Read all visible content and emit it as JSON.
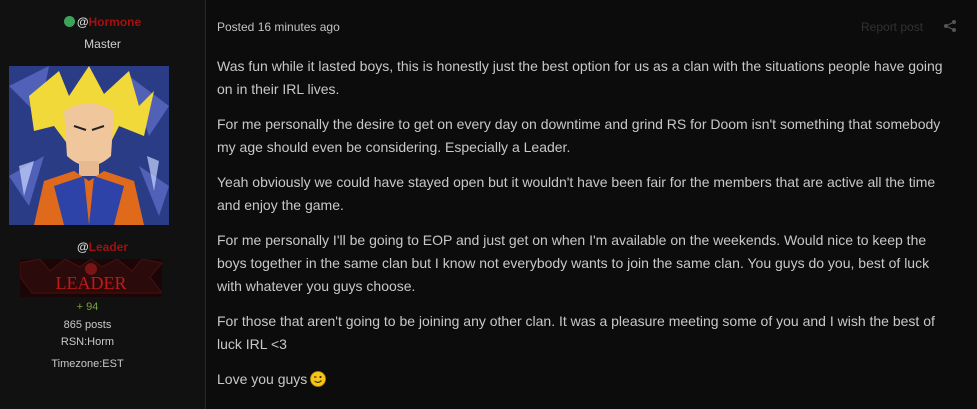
{
  "author": {
    "at": "@",
    "name": "Hormone",
    "rank": "Master",
    "online_color": "#3aa55a",
    "name_color": "#a31010"
  },
  "group": {
    "at": "@",
    "name": "Leader",
    "badge_text": "LEADER"
  },
  "stats": {
    "reputation": "94",
    "posts": "865 posts",
    "rsn": "RSN:Horm",
    "timezone": "Timezone:EST"
  },
  "post": {
    "meta": "Posted 16 minutes ago",
    "report_label": "Report post",
    "share_icon": "share-icon",
    "paragraphs": [
      "Was fun while it lasted boys, this is honestly just the best option for us as a clan with the situations people have going on in their IRL lives.",
      "For me personally the desire to get on every day on downtime and grind RS for Doom isn't something that somebody my age should even be considering.  Especially a Leader.",
      "Yeah obviously we could have stayed open but it wouldn't have been fair for the members that are active all the time and enjoy the game.",
      "For me personally I'll be going to EOP and just get on when I'm available on the weekends.  Would nice to keep the boys together in the same clan but I know not everybody wants to join the same clan.  You guys do you, best of luck with whatever you guys choose.",
      "For those that aren't going to be joining any other clan.  It was a pleasure meeting some of you and I wish the best of luck IRL <3",
      "Love you guys"
    ],
    "emoji": "wink-icon"
  }
}
